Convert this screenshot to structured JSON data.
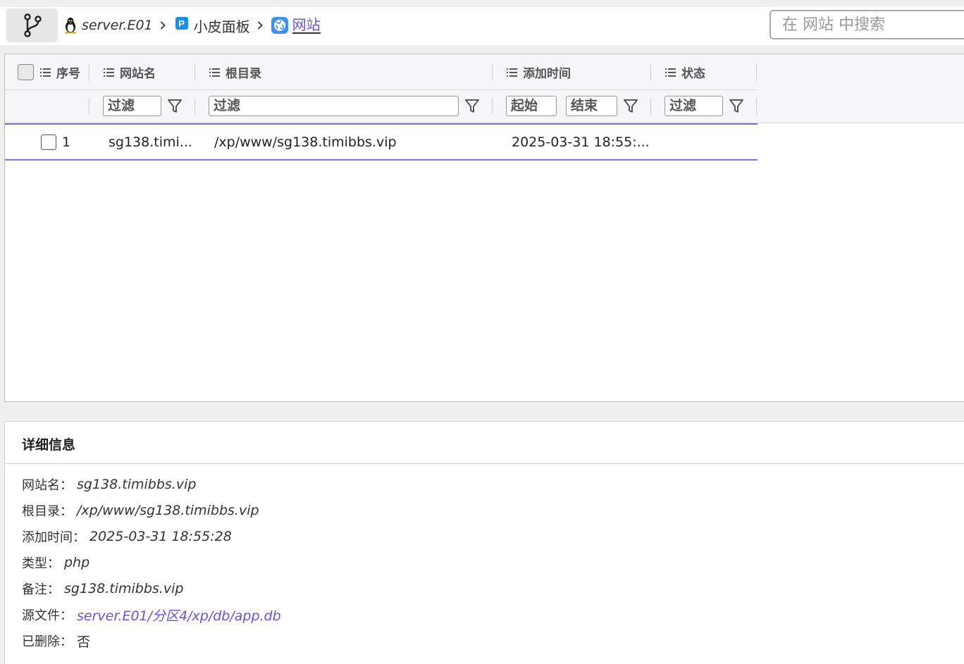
{
  "breadcrumb": {
    "server": "server.E01",
    "panel": "小皮面板",
    "current": "网站"
  },
  "search": {
    "placeholder": "在 网站 中搜索"
  },
  "grid": {
    "columns": [
      {
        "key": "index",
        "label": "序号"
      },
      {
        "key": "name",
        "label": "网站名"
      },
      {
        "key": "root",
        "label": "根目录"
      },
      {
        "key": "added",
        "label": "添加时间"
      },
      {
        "key": "status",
        "label": "状态"
      }
    ],
    "filters": {
      "name": "过滤",
      "root": "过滤",
      "added_start": "起始",
      "added_end": "结束",
      "status": "过滤"
    },
    "rows": [
      {
        "index": "1",
        "name": "sg138.timi...",
        "root": "/xp/www/sg138.timibbs.vip",
        "added": "2025-03-31 18:55:...",
        "status": ""
      }
    ]
  },
  "details": {
    "title": "详细信息",
    "items": [
      {
        "key": "网站名：",
        "value": "sg138.timibbs.vip"
      },
      {
        "key": "根目录：",
        "value": "/xp/www/sg138.timibbs.vip"
      },
      {
        "key": "添加时间：",
        "value": "2025-03-31 18:55:28"
      },
      {
        "key": "类型：",
        "value": "php"
      },
      {
        "key": "备注：",
        "value": "sg138.timibbs.vip"
      },
      {
        "key": "源文件：",
        "value": "server.E01/分区4/xp/db/app.db"
      },
      {
        "key": "已删除：",
        "value": "否"
      }
    ]
  },
  "colors": {
    "accent": "#6e4ee0",
    "row_border": "#7b6cf0",
    "panel_badge": "#1a8fe3"
  }
}
